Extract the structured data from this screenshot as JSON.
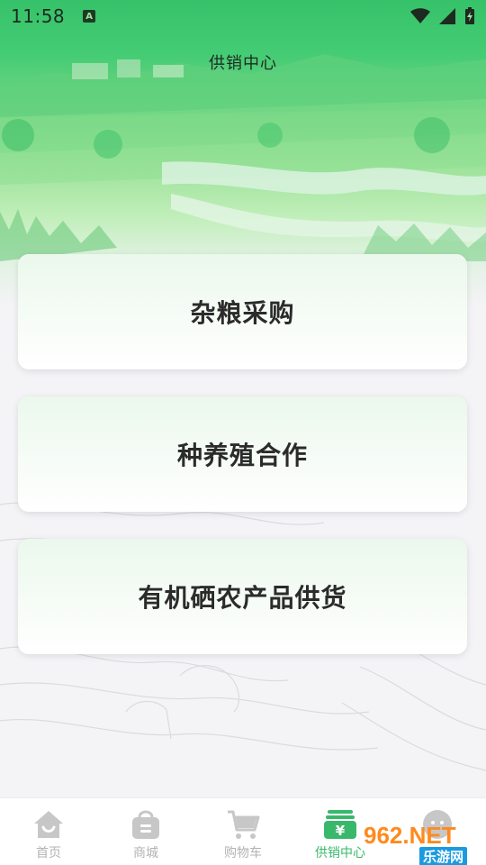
{
  "status_bar": {
    "time": "11:58",
    "notification_badge": "A",
    "icons": [
      "wifi-icon",
      "signal-icon",
      "battery-charging-icon"
    ]
  },
  "header": {
    "title": "供销中心"
  },
  "cards": [
    {
      "label": "杂粮采购"
    },
    {
      "label": "种养殖合作"
    },
    {
      "label": "有机硒农产品供货"
    }
  ],
  "bottom_nav": {
    "items": [
      {
        "label": "首页",
        "icon": "home-icon",
        "active": false
      },
      {
        "label": "商城",
        "icon": "shopping-bag-icon",
        "active": false
      },
      {
        "label": "购物车",
        "icon": "cart-icon",
        "active": false
      },
      {
        "label": "供销中心",
        "icon": "yuan-wallet-icon",
        "active": true
      },
      {
        "label": "",
        "icon": "profile-icon",
        "active": false
      }
    ]
  },
  "watermark": {
    "main": "962.NET",
    "sub": "乐游网"
  },
  "colors": {
    "accent": "#39b86b",
    "inactive": "#b3b3b3",
    "header_green": "#45cc74"
  }
}
